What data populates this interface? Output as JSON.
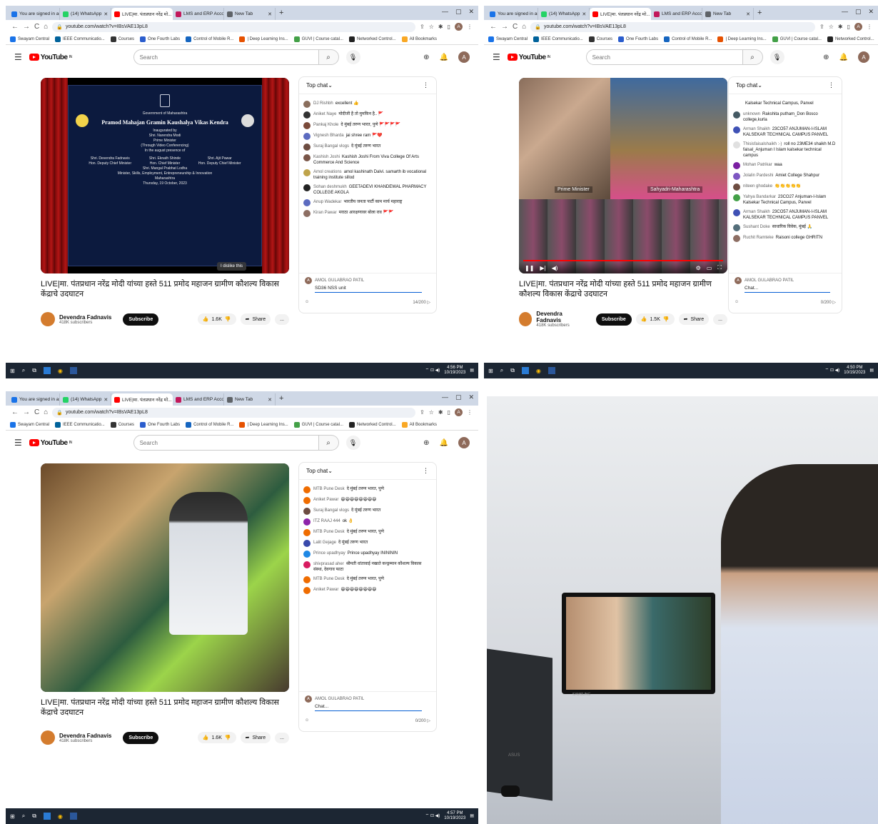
{
  "browser": {
    "tabs": [
      {
        "label": "You are signed in as agpatil",
        "color": "#1a73e8"
      },
      {
        "label": "(14) WhatsApp",
        "color": "#25d366"
      },
      {
        "label": "LIVE|मा. पंतप्रधान नरेंद्र मो...",
        "color": "#ff0000"
      },
      {
        "label": "LMS and ERP Account Login",
        "color": "#c2185b"
      },
      {
        "label": "New Tab",
        "color": "#5f6368"
      }
    ],
    "new_tab": "+",
    "url": "youtube.com/watch?v=IBsVAE13pL8",
    "bookmarks": [
      "Swayam Central",
      "IEEE Communicatio...",
      "Courses",
      "One Fourth Labs",
      "Control of Mobile R...",
      "| Deep Learning Ins...",
      "GUVI | Course catal...",
      "Networked Control...",
      "All Bookmarks"
    ],
    "account_initial": "A"
  },
  "youtube": {
    "logo": "YouTube",
    "logo_sup": "IN",
    "search_placeholder": "Search",
    "video_title": "LIVE|मा. पंतप्रधान नरेंद्र मोदी यांच्या हस्ते 511 प्रमोद महाजन ग्रामीण कौशल्य विकास केंद्राचे उदघाटन",
    "channel": "Devendra Fadnavis",
    "subscribers": "418K subscribers",
    "subscribe": "Subscribe",
    "share": "Share",
    "more": "...",
    "top_chat": "Top chat"
  },
  "panels": [
    {
      "likes": "1.6K",
      "tooltip": "I dislike this",
      "screen_lines": [
        "Government of Maharashtra",
        "Pramod Mahajan Gramin Kaushalya Vikas Kendra",
        "Inaugurated by",
        "Shri. Narendra Modi",
        "Prime Minister",
        "(Through Video Conferencing)",
        "In the august presence of",
        "Shri. Eknath Shinde",
        "Hon. Chief Minister",
        "Shri. Devendra Fadnavis",
        "Hon. Deputy Chief Minister",
        "Shri. Ajit Pawar",
        "Hon. Deputy Chief Minister",
        "Shri. Mangal Prabhat Lodha",
        "Minister, Skills, Employment, Entrepreneurship & Innovation",
        "Maharashtra",
        "Thursday, 19 October, 2023"
      ],
      "chat": [
        {
          "author": "DJ Rishbh",
          "text": "excellent 👍",
          "color": "#8a6e5c"
        },
        {
          "author": "Aniket Naye",
          "text": "मोदीजी है तो मुमकिन है.. 🚩",
          "color": "#333"
        },
        {
          "author": "Pankaj Khole",
          "text": "दे मुंबई तरुण भारत, पुणे 🚩🚩🚩🚩",
          "color": "#7b4a3a"
        },
        {
          "author": "Vignesh Bharda",
          "text": "jai shree ram 🚩❤️",
          "color": "#5c6bc0"
        },
        {
          "author": "Suraj Bangal vlogs",
          "text": "दे मुंबई तरुण भारत",
          "color": "#6d4c41"
        },
        {
          "author": "Kashish Joshi",
          "text": "Kashish Joshi From Viva College Of Arts Commerce And Science",
          "color": "#795548"
        },
        {
          "author": "Amol creations",
          "text": "amol kashinath Dalvi. samarth ib vocational training institute sillod",
          "color": "#bfa34a"
        },
        {
          "author": "Sohan deshmukh",
          "text": "GEETADEVI KHANDEWAL PHARMACY COLLEGE AKOLA",
          "color": "#222"
        },
        {
          "author": "Anup Wadekar",
          "text": "भारतीय जनता पार्टी काम मार्च महाराष्ट्र",
          "color": "#5c6bc0"
        },
        {
          "author": "Kiran Pawar",
          "text": "मराठा आरक्षणावर बोला राव 🚩🚩",
          "color": "#8d6e63"
        }
      ],
      "input_user": "AMOL GULABRAO PATIL",
      "input_text": "SD36 NSS unit",
      "counter": "14/200",
      "time": "4:56 PM",
      "date": "10/19/2023"
    },
    {
      "likes": "1.5K",
      "video_captions": [
        "Prime Minister",
        "Sahyadri-Maharashtra"
      ],
      "chat": [
        {
          "author": "",
          "text": "Kalsekar Technical Campus, Panvel",
          "color": "#fff"
        },
        {
          "author": "unknown",
          "text": "Rakshita putham_Don Bosco college,kurla",
          "color": "#455a64"
        },
        {
          "author": "Arman Shaikh",
          "text": "23CO57 ANJUMAN-I-ISLAM KALSEKAR TECHNICAL CAMPUS PANVEL",
          "color": "#3f51b5"
        },
        {
          "author": "Thisisfaisalshaikh :-)",
          "text": "roll no 23ME34 shaikh M.D faisal_Anjuman I Islam kalsekar technical campus",
          "color": "#e0e0e0"
        },
        {
          "author": "Mohan Patrikar",
          "text": "waa",
          "color": "#7b1fa2"
        },
        {
          "author": "Jolalin Pardeshi",
          "text": "Amiet College Shahpur",
          "color": "#7e57c2"
        },
        {
          "author": "niteen ghodake",
          "text": "👏👏👏👏👏",
          "color": "#6d4c41"
        },
        {
          "author": "Yahya Bandarkar",
          "text": "23CO27 Anjuman-I-Islam Kalsekar Technical Campus, Panvel",
          "color": "#43a047"
        },
        {
          "author": "Arman Shaikh",
          "text": "23CO57 ANJUMAN-I-ISLAM KALSEKAR TECHNICAL CAMPUS PANVEL",
          "color": "#3f51b5"
        },
        {
          "author": "Sushant Doke",
          "text": "साधारिक विवेक, मुंबई 🙏",
          "color": "#546e7a"
        },
        {
          "author": "Ruchit Ramteke",
          "text": "Raisoni college GHRITN",
          "color": "#8d6e63"
        }
      ],
      "input_user": "AMOL GULABRAO PATIL",
      "input_text": "Chat...",
      "counter": "0/200",
      "time": "4:50 PM",
      "date": "10/19/2023"
    },
    {
      "likes": "1.6K",
      "chat": [
        {
          "author": "MTB Pune Desk",
          "text": "दे मुंबई तरुण भारत, पुणे",
          "color": "#ef6c00"
        },
        {
          "author": "Aniket Pawar",
          "text": "😆😆😆😆😆😆😆😆",
          "color": "#ef6c00"
        },
        {
          "author": "Suraj Bangal vlogs",
          "text": "दे मुंबई तरुण भारत",
          "color": "#6d4c41"
        },
        {
          "author": "ITZ RAAJ 444",
          "text": "ok 👌",
          "color": "#8e24aa"
        },
        {
          "author": "MTB Pune Desk",
          "text": "दे मुंबई तरुण भारत, पुणे",
          "color": "#ef6c00"
        },
        {
          "author": "Lalit Gejage",
          "text": "दे मुंबई तरुण भारत",
          "color": "#3949ab"
        },
        {
          "author": "Prince upadhyay",
          "text": "Prince upadhyay ININININ",
          "color": "#1e88e5"
        },
        {
          "author": "shivprasad aher",
          "text": "श्रीमती धांतावाई नखाते कन्ड्रम्मान कौशल्य विकास संस्था, देवगाव फाटा",
          "color": "#d81b60"
        },
        {
          "author": "MTB Pune Desk",
          "text": "दे मुंबई तरुण भारत, पुणे",
          "color": "#ef6c00"
        },
        {
          "author": "Aniket Pawar",
          "text": "😆😆😆😆😆😆😆😆",
          "color": "#ef6c00"
        }
      ],
      "input_user": "AMOL GULABRAO PATIL",
      "input_text": "Chat...",
      "counter": "0/200",
      "time": "4:57 PM",
      "date": "10/19/2023"
    }
  ],
  "photo": {
    "monitor_brand": "SAMSUNG",
    "laptop_brand": "ASUS"
  }
}
